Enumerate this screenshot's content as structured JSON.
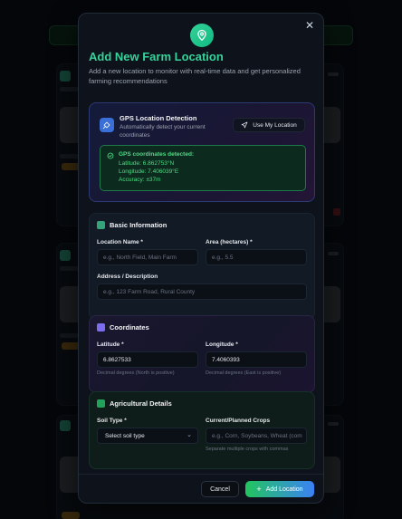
{
  "modal": {
    "title": "Add New Farm Location",
    "subtitle": "Add a new location to monitor with real-time data and get personalized farming recommendations",
    "close_icon": "close-icon",
    "hero_icon": "map-pin-icon"
  },
  "gps": {
    "title": "GPS Location Detection",
    "description": "Automatically detect your current coordinates",
    "button_label": "Use My Location",
    "status_head": "GPS coordinates detected:",
    "latitude_line": "Latitude: 6.862753°N",
    "longitude_line": "Longitude: 7.406039°E",
    "accuracy_line": "Accuracy: ±37m"
  },
  "basic": {
    "heading": "Basic Information",
    "location_name_label": "Location Name *",
    "location_name_placeholder": "e.g., North Field, Main Farm",
    "area_label": "Area (hectares) *",
    "area_placeholder": "e.g., 5.5",
    "address_label": "Address / Description",
    "address_placeholder": "e.g., 123 Farm Road, Rural County"
  },
  "coordinates": {
    "heading": "Coordinates",
    "latitude_label": "Latitude *",
    "latitude_value": "6.8627533",
    "latitude_hint": "Decimal degrees (North is positive)",
    "longitude_label": "Longitude *",
    "longitude_value": "7.4060393",
    "longitude_hint": "Decimal degrees (East is positive)"
  },
  "agri": {
    "heading": "Agricultural Details",
    "soil_label": "Soil Type *",
    "soil_value": "Select soil type",
    "crops_label": "Current/Planned Crops",
    "crops_placeholder": "e.g., Corn, Soybeans, Wheat (com",
    "crops_hint": "Separate multiple crops with commas"
  },
  "footer": {
    "cancel_label": "Cancel",
    "add_label": "Add Location"
  },
  "colors": {
    "accent": "#34d399",
    "gps_border": "#2b3a72",
    "success": "#4ade80",
    "primary_gradient_start": "#22c55e",
    "primary_gradient_end": "#3b82f6"
  }
}
